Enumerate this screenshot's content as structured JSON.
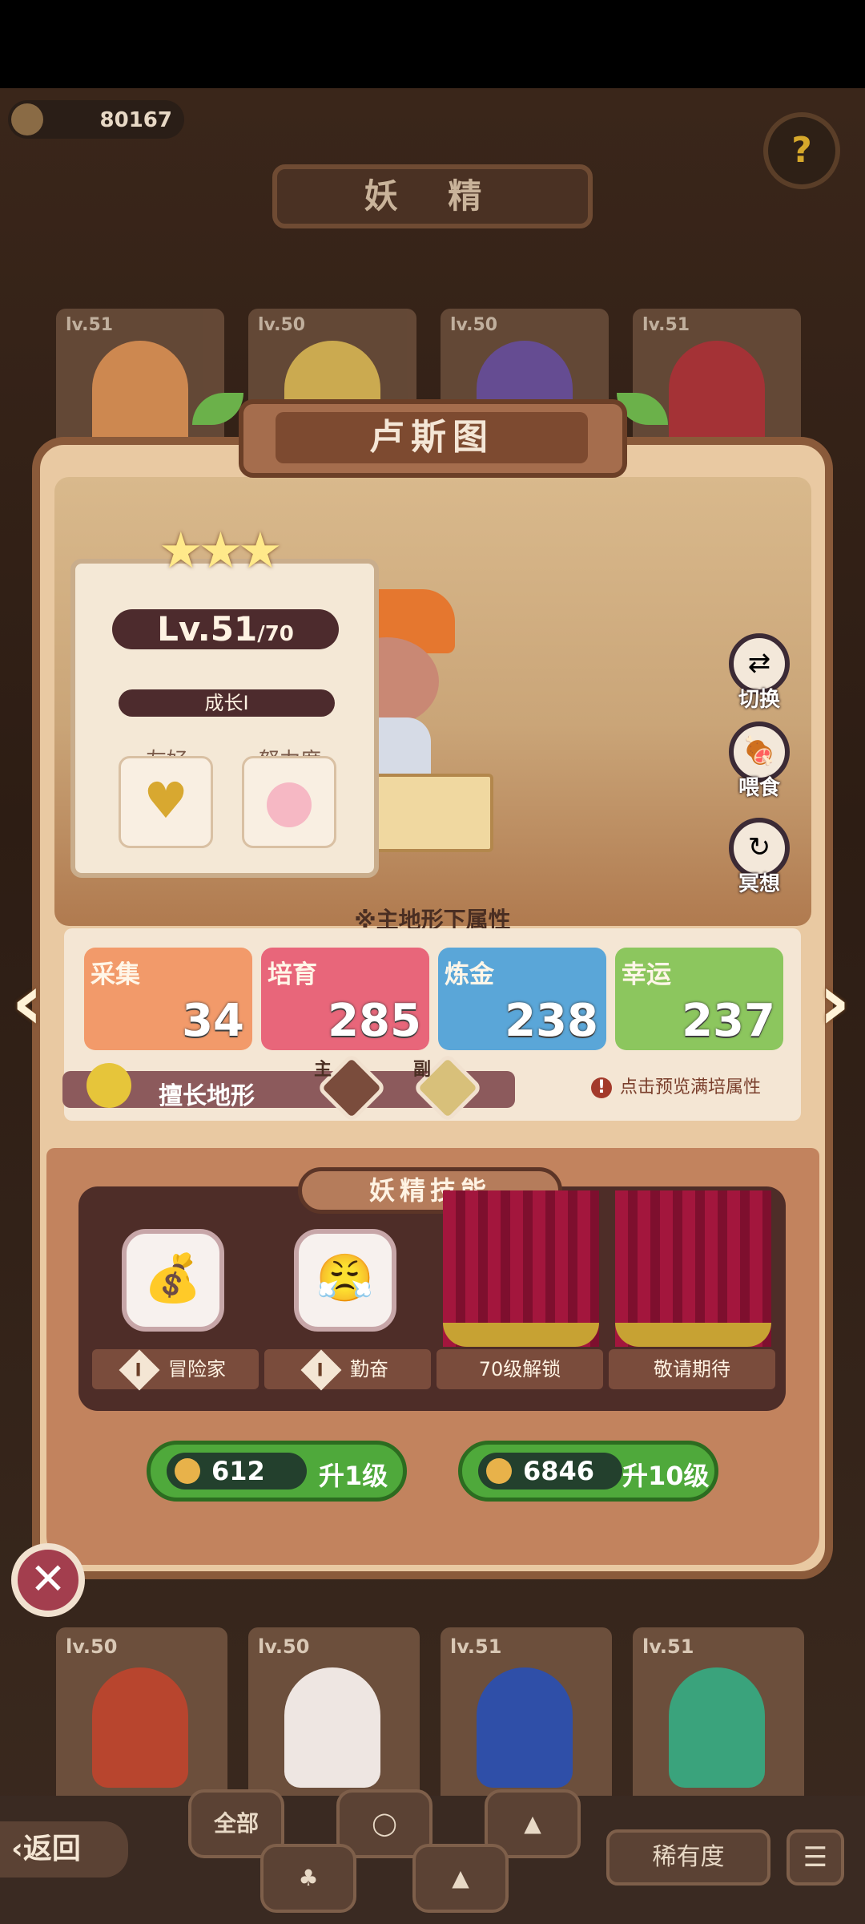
{
  "currency": {
    "amount": "80167",
    "icon": "crown-coin-icon"
  },
  "header": {
    "title": "妖 精",
    "help_icon": "question-sprout-icon"
  },
  "background_cards": [
    {
      "level": "lv.51"
    },
    {
      "level": "lv.50"
    },
    {
      "level": "lv.50"
    },
    {
      "level": "lv.51"
    }
  ],
  "fairy": {
    "name": "卢斯图",
    "level": "Lv.51",
    "max_level": "/70",
    "stars": "★★★",
    "growth": "成长I",
    "friendly_label": "友好",
    "effort_label": "努力度"
  },
  "actions": [
    {
      "label": "切换",
      "icon": "swap-icon"
    },
    {
      "label": "喂食",
      "icon": "meat-icon"
    },
    {
      "label": "冥想",
      "icon": "meditate-icon"
    }
  ],
  "attributes": {
    "header": "※主地形下属性",
    "items": [
      {
        "name": "采集",
        "value": "34",
        "color": "#f29a6a"
      },
      {
        "name": "培育",
        "value": "285",
        "color": "#e8667a"
      },
      {
        "name": "炼金",
        "value": "238",
        "color": "#5aa6d8"
      },
      {
        "name": "幸运",
        "value": "237",
        "color": "#8cc65e"
      }
    ],
    "terrain_label": "擅长地形",
    "terrain_main": "主",
    "terrain_sub": "副",
    "hint": "点击预览满培属性"
  },
  "skills": {
    "title": "妖精技能",
    "items": [
      {
        "label": "冒险家",
        "rank": "I",
        "icon": "adventurer-bag-icon"
      },
      {
        "label": "勤奋",
        "rank": "I",
        "icon": "diligent-face-icon"
      },
      {
        "label": "70级解锁"
      },
      {
        "label": "敬请期待"
      }
    ]
  },
  "upgrade": [
    {
      "cost": "612",
      "label": "升1级"
    },
    {
      "cost": "6846",
      "label": "升10级"
    }
  ],
  "bottom_cards": [
    {
      "level": "lv.50"
    },
    {
      "level": "lv.50"
    },
    {
      "level": "lv.51"
    },
    {
      "level": "lv.51"
    }
  ],
  "footer": {
    "back": "返回",
    "filter_all": "全部",
    "rarity": "稀有度"
  }
}
